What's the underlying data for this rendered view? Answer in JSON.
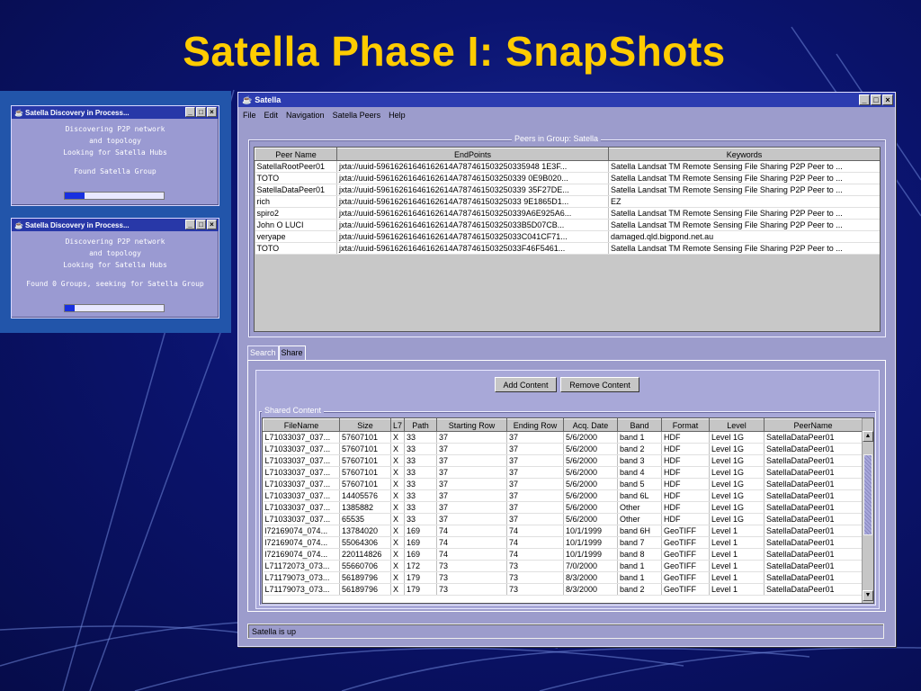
{
  "slide": {
    "title": "Satella Phase I: SnapShots"
  },
  "discovery_windows": [
    {
      "title": "Satella Discovery in Process...",
      "lines": [
        "Discovering P2P network",
        "and topology",
        "Looking for Satella Hubs"
      ],
      "status": "Found Satella Group",
      "progress": 0.2
    },
    {
      "title": "Satella Discovery in Process...",
      "lines": [
        "Discovering P2P network",
        "and topology",
        "Looking for Satella Hubs"
      ],
      "status": "Found 0 Groups, seeking for Satella Group",
      "progress": 0.1
    }
  ],
  "window": {
    "title": "Satella",
    "menu": [
      "File",
      "Edit",
      "Navigation",
      "Satella Peers",
      "Help"
    ]
  },
  "peers": {
    "legend": "Peers in Group: Satella",
    "columns": [
      "Peer Name",
      "EndPoints",
      "Keywords"
    ],
    "rows": [
      [
        "SatellaRootPeer01",
        "jxta://uuid-59616261646162614A787461503250335948 1E3F...",
        "Satella Landsat TM Remote Sensing File Sharing P2P Peer to ..."
      ],
      [
        "TOTO",
        "jxta://uuid-59616261646162614A787461503250339 0E9B020...",
        "Satella Landsat TM Remote Sensing File Sharing P2P Peer to ..."
      ],
      [
        "SatellaDataPeer01",
        "jxta://uuid-59616261646162614A787461503250339 35F27DE...",
        "Satella Landsat TM Remote Sensing File Sharing P2P Peer to ..."
      ],
      [
        "rich",
        "jxta://uuid-59616261646162614A78746150325033 9E1865D1...",
        "EZ"
      ],
      [
        "spiro2",
        "jxta://uuid-59616261646162614A787461503250339A6E925A6...",
        "Satella Landsat TM Remote Sensing File Sharing P2P Peer to ..."
      ],
      [
        "John O LUCI",
        "jxta://uuid-59616261646162614A78746150325033B5D07CB...",
        "Satella Landsat TM Remote Sensing File Sharing P2P Peer to ..."
      ],
      [
        "veryape",
        "jxta://uuid-59616261646162614A78746150325033C041CF71...",
        "damaged.qld.bigpond.net.au"
      ],
      [
        "TOTO",
        "jxta://uuid-59616261646162614A78746150325033F46F5461...",
        "Satella Landsat TM Remote Sensing File Sharing P2P Peer to ..."
      ]
    ]
  },
  "tabs": [
    "Search",
    "Share"
  ],
  "active_tab": "Share",
  "share": {
    "add_button": "Add Content",
    "remove_button": "Remove Content",
    "legend": "Shared Content",
    "columns": [
      "FileName",
      "Size",
      "L7",
      "Path",
      "Starting Row",
      "Ending Row",
      "Acq. Date",
      "Band",
      "Format",
      "Level",
      "PeerName"
    ],
    "rows": [
      [
        "L71033037_037...",
        "57607101",
        "X",
        "33",
        "37",
        "37",
        "5/6/2000",
        "band 1",
        "HDF",
        "Level 1G",
        "SatellaDataPeer01"
      ],
      [
        "L71033037_037...",
        "57607101",
        "X",
        "33",
        "37",
        "37",
        "5/6/2000",
        "band 2",
        "HDF",
        "Level 1G",
        "SatellaDataPeer01"
      ],
      [
        "L71033037_037...",
        "57607101",
        "X",
        "33",
        "37",
        "37",
        "5/6/2000",
        "band 3",
        "HDF",
        "Level 1G",
        "SatellaDataPeer01"
      ],
      [
        "L71033037_037...",
        "57607101",
        "X",
        "33",
        "37",
        "37",
        "5/6/2000",
        "band 4",
        "HDF",
        "Level 1G",
        "SatellaDataPeer01"
      ],
      [
        "L71033037_037...",
        "57607101",
        "X",
        "33",
        "37",
        "37",
        "5/6/2000",
        "band 5",
        "HDF",
        "Level 1G",
        "SatellaDataPeer01"
      ],
      [
        "L71033037_037...",
        "14405576",
        "X",
        "33",
        "37",
        "37",
        "5/6/2000",
        "band 6L",
        "HDF",
        "Level 1G",
        "SatellaDataPeer01"
      ],
      [
        "L71033037_037...",
        "1385882",
        "X",
        "33",
        "37",
        "37",
        "5/6/2000",
        "Other",
        "HDF",
        "Level 1G",
        "SatellaDataPeer01"
      ],
      [
        "L71033037_037...",
        "65535",
        "X",
        "33",
        "37",
        "37",
        "5/6/2000",
        "Other",
        "HDF",
        "Level 1G",
        "SatellaDataPeer01"
      ],
      [
        "l72169074_074...",
        "13784020",
        "X",
        "169",
        "74",
        "74",
        "10/1/1999",
        "band 6H",
        "GeoTIFF",
        "Level 1",
        "SatellaDataPeer01"
      ],
      [
        "l72169074_074...",
        "55064306",
        "X",
        "169",
        "74",
        "74",
        "10/1/1999",
        "band 7",
        "GeoTIFF",
        "Level 1",
        "SatellaDataPeer01"
      ],
      [
        "l72169074_074...",
        "220114826",
        "X",
        "169",
        "74",
        "74",
        "10/1/1999",
        "band 8",
        "GeoTIFF",
        "Level 1",
        "SatellaDataPeer01"
      ],
      [
        "L71172073_073...",
        "55660706",
        "X",
        "172",
        "73",
        "73",
        "7/0/2000",
        "band 1",
        "GeoTIFF",
        "Level 1",
        "SatellaDataPeer01"
      ],
      [
        "L71179073_073...",
        "56189796",
        "X",
        "179",
        "73",
        "73",
        "8/3/2000",
        "band 1",
        "GeoTIFF",
        "Level 1",
        "SatellaDataPeer01"
      ],
      [
        "L71179073_073...",
        "56189796",
        "X",
        "179",
        "73",
        "73",
        "8/3/2000",
        "band 2",
        "GeoTIFF",
        "Level 1",
        "SatellaDataPeer01"
      ]
    ]
  },
  "status": "Satella is up",
  "icons": {
    "app": "java-cup-icon",
    "minimize": "minimize-icon",
    "maximize": "maximize-icon",
    "close": "close-icon"
  },
  "colors": {
    "title_text": "#ffcc00",
    "window_bg": "#9c9ccc",
    "title_bar": "#2c3cb0",
    "progress": "#1830e0"
  }
}
